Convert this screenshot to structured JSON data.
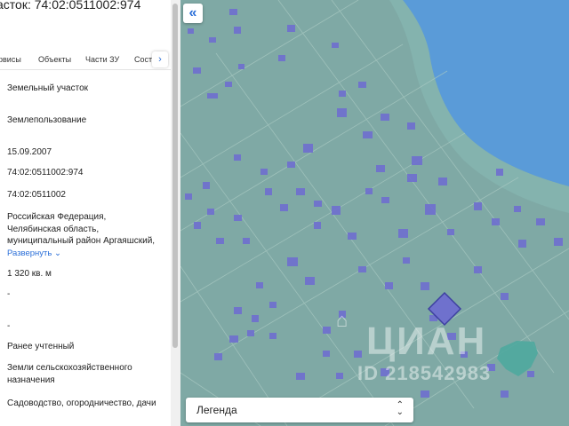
{
  "panel": {
    "title": "асток: 74:02:0511002:974",
    "tabs": [
      "рвисы",
      "Объекты",
      "Части ЗУ",
      "Соста"
    ],
    "tab_next_icon": "›",
    "fields": [
      "Земельный участок",
      "Землепользование",
      "15.09.2007",
      "74:02:0511002:974",
      "74:02:0511002",
      "Российская Федерация,",
      "Челябинская область,",
      "муниципальный район Аргаяшский,",
      "1 320 кв. м",
      "-",
      "-",
      "Ранее учтенный",
      "Земли сельскохозяйственного",
      "назначения",
      "Садоводство, огородничество, дачи"
    ],
    "expand_label": "Развернуть",
    "expand_icon": "⌄"
  },
  "map": {
    "collapse_icon": "«",
    "legend_label": "Легенда",
    "legend_icon_up": "⌃",
    "legend_icon_down": "⌄",
    "watermark_text": "ЦИАН",
    "watermark_id": "ID 218542983",
    "water_color": "#5a9bd8",
    "land_color": "#7fa9a5",
    "parcel_color": "#6f6fd0"
  }
}
